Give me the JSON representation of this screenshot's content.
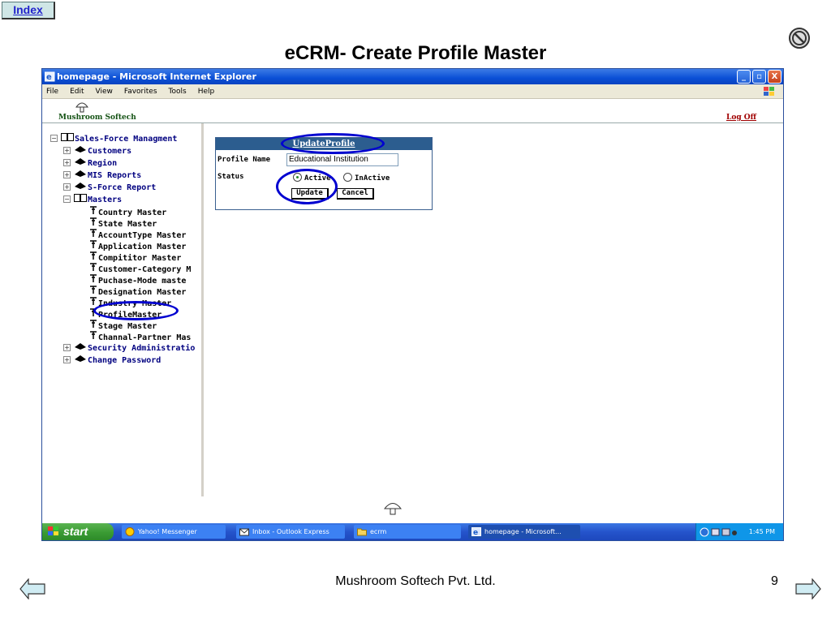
{
  "slide": {
    "index_label": "Index",
    "title": "eCRM- Create Profile Master",
    "company": "Mushroom Softech Pvt. Ltd.",
    "page_number": "9"
  },
  "window": {
    "title": "homepage - Microsoft Internet Explorer",
    "controls": [
      "_",
      "▫",
      "X"
    ],
    "menu": [
      "File",
      "Edit",
      "View",
      "Favorites",
      "Tools",
      "Help"
    ]
  },
  "app_header": {
    "brand": "Mushroom Softech",
    "logoff": "Log Off"
  },
  "tree": {
    "root": "Sales-Force Managment",
    "nodes": [
      "Customers",
      "Region",
      "MIS Reports",
      "S-Force Report",
      "Masters"
    ],
    "masters": [
      "Country Master",
      "State Master",
      "AccountType Master",
      "Application Master",
      "Compititor Master",
      "Customer-Category M",
      "Puchase-Mode maste",
      "Designation Master",
      "Industry Master",
      "ProfileMaster",
      "Stage Master",
      "Channal-Partner Mas"
    ],
    "after": [
      "Security Administratio",
      "Change Password"
    ]
  },
  "form": {
    "header": "UpdateProfile",
    "profile_name_label": "Profile Name",
    "profile_name_value": "Educational Institution",
    "status_label": "Status",
    "status_active": "Active",
    "status_inactive": "InActive",
    "update_button": "Update",
    "cancel_button": "Cancel"
  },
  "taskbar": {
    "start": "start",
    "items": [
      "Yahoo! Messenger",
      "Inbox - Outlook Express",
      "ecrm",
      "homepage - Microsoft..."
    ],
    "clock": "1:45 PM"
  },
  "colors": {
    "title_bar": "#0a4fd6",
    "form_header": "#2c5d8f",
    "highlight": "#0000d0",
    "tree_text": "#000080"
  }
}
